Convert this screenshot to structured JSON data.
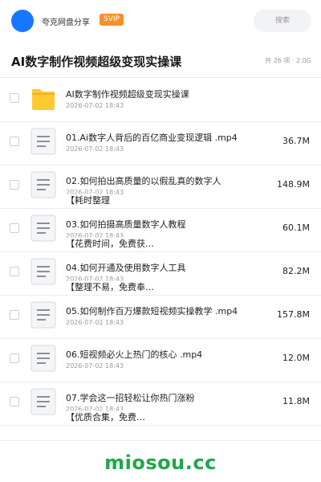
{
  "header": {
    "brand": "夸克网盘分享",
    "badge": "SVIP",
    "search_placeholder": "搜索"
  },
  "title": "AI数字制作视频超级变现实操课",
  "meta": "共 26 项 · 2.0G",
  "items": [
    {
      "type": "folder",
      "name": "AI数字制作视频超级变现实操课",
      "name2": "",
      "date": "2026-07-02 18:43",
      "size": ""
    },
    {
      "type": "file",
      "name": "01.Ai数字人背后的百亿商业变现逻辑 .mp4",
      "name2": "",
      "date": "2026-07-02 18:43",
      "size": "36.7M"
    },
    {
      "type": "file",
      "name": "02.如何拍出高质量的以假乱真的数字人",
      "name2": "【耗时整理",
      "date": "2026-07-02 18:43",
      "size": "148.9M"
    },
    {
      "type": "file",
      "name": "03.如何拍摄高质量数字人教程",
      "name2": "【花费时间，免费获…",
      "date": "2026-07-02 18:43",
      "size": "60.1M"
    },
    {
      "type": "file",
      "name": "04.如何开通及使用数字人工具",
      "name2": "【整理不易，免费奉…",
      "date": "2026-07-02 18:43",
      "size": "82.2M"
    },
    {
      "type": "file",
      "name": "05.如何制作百万爆款短视频实操教学 .mp4",
      "name2": "",
      "date": "2026-07-02 18:43",
      "size": "157.8M"
    },
    {
      "type": "file",
      "name": "06.短视频必火上热门的核心 .mp4",
      "name2": "",
      "date": "2026-07-02 18:43",
      "size": "12.0M"
    },
    {
      "type": "file",
      "name": "07.学会这一招轻松让你热门涨粉",
      "name2": "【优质合集，免费…",
      "date": "2026-07-02 18:43",
      "size": "11.8M"
    }
  ],
  "icons": {
    "folder": "folder-icon",
    "file": "document-icon"
  },
  "colors": {
    "accent": "#1677ff",
    "badge": "#f5902b",
    "folder": "#ffc933",
    "watermark": "#1fa84a"
  },
  "watermark": "miosou.cc"
}
